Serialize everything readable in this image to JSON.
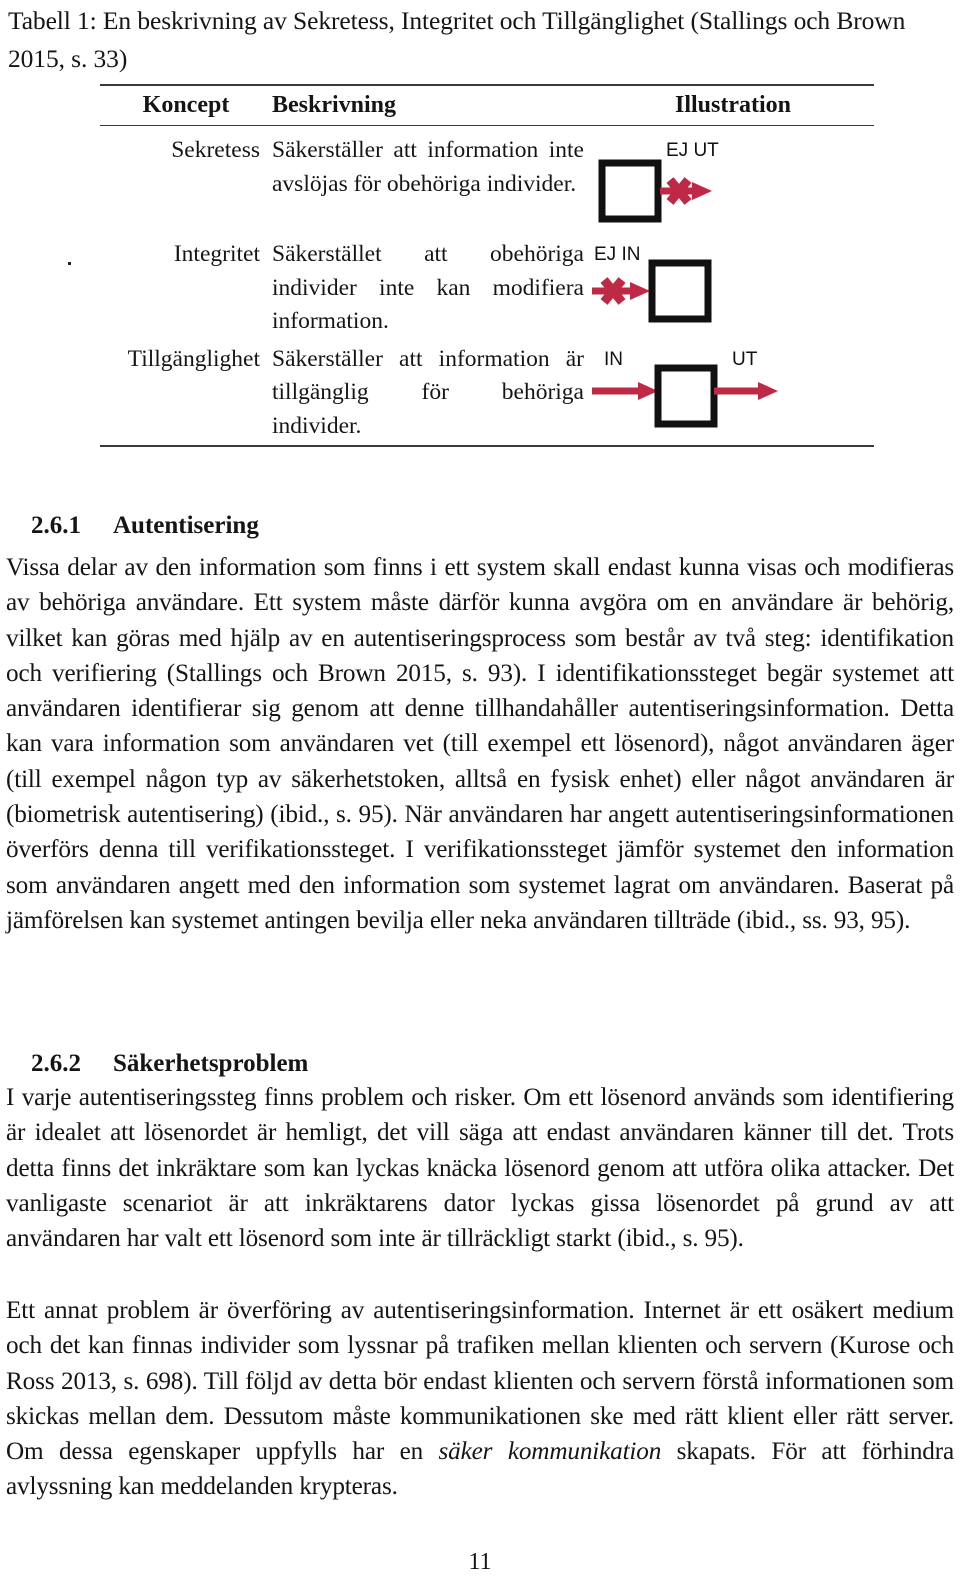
{
  "caption": {
    "text": "Tabell 1: En beskrivning av Sekretess, Integritet och Tillgänglighet (Stallings och Brown 2015, s. 33)"
  },
  "table": {
    "headers": {
      "koncept": "Koncept",
      "beskrivning": "Beskrivning",
      "illustration": "Illustration"
    },
    "rows": [
      {
        "koncept": "Sekretess",
        "beskrivning": "Säkerställer att information inte avslöjas för obehöriga individer.",
        "illustration": {
          "name": "box-blocked-out",
          "labels": [
            "EJ UT"
          ],
          "arrow_color": "#BE2A45",
          "box_color": "#111111"
        }
      },
      {
        "koncept": "Integritet",
        "beskrivning": "Säkerstället att obehöriga individer inte kan modifiera information.",
        "illustration": {
          "name": "box-blocked-in",
          "labels": [
            "EJ IN"
          ],
          "arrow_color": "#BE2A45",
          "box_color": "#111111"
        }
      },
      {
        "koncept": "Tillgänglighet",
        "beskrivning": "Säkerställer att information är tillgänglig för behöriga individer.",
        "illustration": {
          "name": "box-in-out",
          "labels": [
            "IN",
            "UT"
          ],
          "arrow_color": "#BE2A45",
          "box_color": "#111111"
        }
      }
    ]
  },
  "sections": [
    {
      "number": "2.6.1",
      "title": "Autentisering",
      "paragraphs": [
        "Vissa delar av den information som finns i ett system skall endast kunna visas och modifieras av behöriga användare. Ett system måste därför kunna avgöra om en användare är behörig, vilket kan göras med hjälp av en autentiseringsprocess som består av två steg: identifikation och verifiering (Stallings och Brown 2015, s. 93). I identifikationssteget begär systemet att användaren identifierar sig genom att denne tillhandahåller autentiseringsinformation. Detta kan vara information som använda­ren vet (till exempel ett lösenord), något användaren äger (till exempel någon typ av säkerhetstoken, alltså en fysisk enhet) eller något användaren är (biometrisk autentisering) (ibid., s. 95). När användaren har angett autentiseringsinformationen överförs denna till verifikationssteget. I verifikationssteget jämför systemet den information som användaren angett med den information som systemet lagrat om användaren. Baserat på jämförelsen kan systemet antingen bevilja eller neka användaren tillträde (ibid., ss. 93, 95)."
      ]
    },
    {
      "number": "2.6.2",
      "title": "Säkerhetsproblem",
      "paragraphs": [
        "I varje autentiseringssteg finns problem och risker. Om ett lösenord används som identifiering är idealet att lösenordet är hemligt, det vill säga att endast användaren känner till det. Trots detta finns det inkräktare som kan lyckas knäcka lösenord genom att utföra olika attacker. Det vanligaste scenariot är att inkräktarens dator lyckas gissa lösenordet på grund av att användaren har valt ett lösenord som inte är tillräckligt starkt (ibid., s. 95).",
        "Ett annat problem är överföring av autentiseringsinformation. Internet är ett osäkert medium och det kan finnas individer som lyssnar på trafiken mellan klienten och servern (Kurose och Ross 2013, s. 698). Till följd av detta bör endast klienten och servern förstå informationen som skickas mellan dem. Dessutom måste kommunikationen ske med rätt klient eller rätt server. Om dessa egenskaper uppfylls har en "
      ],
      "emphasis": "säker kommunikation",
      "paragraph2_tail": " skapats. För att förhindra avlyssning kan meddelanden krypteras."
    }
  ],
  "folio": "11"
}
